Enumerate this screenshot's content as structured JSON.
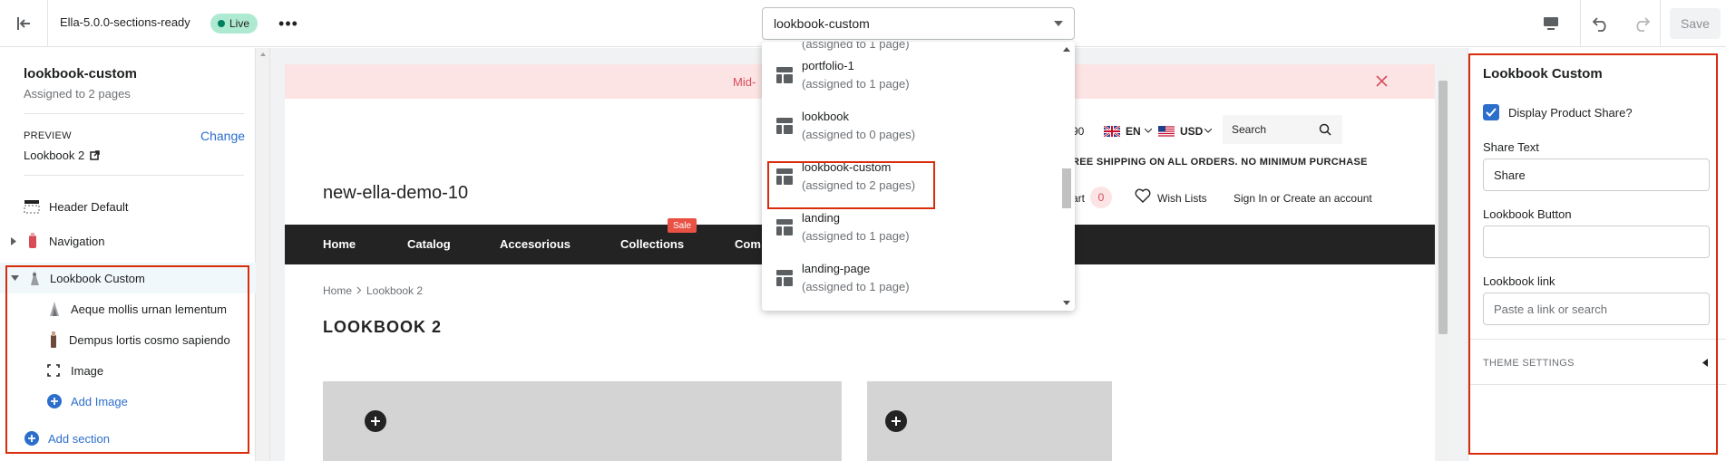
{
  "topbar": {
    "theme_name": "Ella-5.0.0-sections-ready",
    "live_label": "Live",
    "template_selected": "lookbook-custom",
    "save_label": "Save"
  },
  "left": {
    "template_title": "lookbook-custom",
    "assigned": "Assigned to 2 pages",
    "preview_label": "PREVIEW",
    "change_label": "Change",
    "preview_value": "Lookbook 2",
    "sections": {
      "header": "Header Default",
      "navigation": "Navigation",
      "lookbook": "Lookbook Custom",
      "block1": "Aeque mollis urnan lementum",
      "block2": "Dempus lortis cosmo sapiendo",
      "block3": "Image",
      "add_image": "Add Image",
      "add_section": "Add section"
    }
  },
  "store": {
    "announcement": "Mid-",
    "phone_fragment": "90",
    "lang": "EN",
    "currency": "USD",
    "search_placeholder": "Search",
    "shipping": "REE SHIPPING ON ALL ORDERS. NO MINIMUM PURCHASE",
    "logo": "new-ella-demo-10",
    "cart_fragment": "art",
    "cart_count": "0",
    "wishlist": "Wish Lists",
    "account": "Sign In or Create an account",
    "nav": [
      "Home",
      "Catalog",
      "Accesorious",
      "Collections",
      "Com"
    ],
    "sale_badge": "Sale",
    "breadcrumb_home": "Home",
    "breadcrumb_current": "Lookbook 2",
    "page_heading": "LOOKBOOK 2"
  },
  "dropdown": {
    "partial_top": "(assigned to 1 page)",
    "items": [
      {
        "name": "portfolio-1",
        "assigned": "(assigned to 1 page)"
      },
      {
        "name": "lookbook",
        "assigned": "(assigned to 0 pages)"
      },
      {
        "name": "lookbook-custom",
        "assigned": "(assigned to 2 pages)"
      },
      {
        "name": "landing",
        "assigned": "(assigned to 1 page)"
      },
      {
        "name": "landing-page",
        "assigned": "(assigned to 1 page)"
      }
    ]
  },
  "right": {
    "title": "Lookbook Custom",
    "checkbox_label": "Display Product Share?",
    "checkbox_checked": true,
    "share_text_label": "Share Text",
    "share_text_value": "Share",
    "button_label": "Lookbook Button",
    "button_value": "",
    "link_label": "Lookbook link",
    "link_placeholder": "Paste a link or search",
    "theme_settings": "THEME SETTINGS"
  },
  "colors": {
    "accent_blue": "#2c6ecb",
    "highlight_red": "#d82c0d",
    "live_green": "#aee9d1",
    "nav_dark": "#232323",
    "sale_red": "#e95144"
  }
}
